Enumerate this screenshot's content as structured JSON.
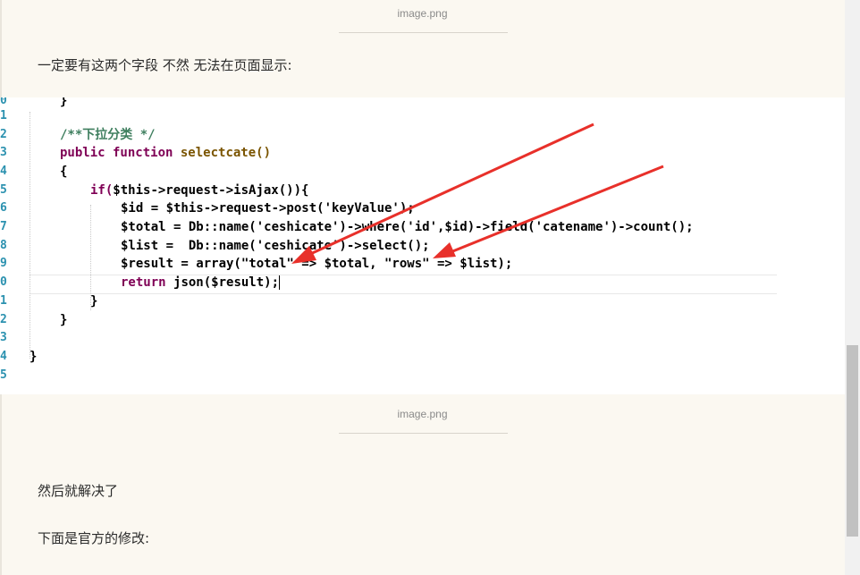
{
  "captions": {
    "top": "image.png",
    "middle": "image.png"
  },
  "paragraphs": {
    "p1": "一定要有这两个字段 不然 无法在页面显示:",
    "p2": "然后就解决了",
    "p3": "下面是官方的修改:"
  },
  "code": {
    "line_numbers": [
      "0",
      "1",
      "2",
      "3",
      "4",
      "5",
      "6",
      "7",
      "8",
      "9",
      "0",
      "1",
      "2",
      "3",
      "4",
      "5"
    ],
    "lines": {
      "l0": "}",
      "l2_comment": "/**下拉分类 */",
      "l3_kw": "public function",
      "l3_fn": "selectcate()",
      "l4": "{",
      "l5_if": "if(",
      "l5_rest": "$this->request->isAjax()){",
      "l6": "$id = $this->request->post('keyValue');",
      "l7": "$total = Db::name('ceshicate')->where('id',$id)->field('catename')->count();",
      "l8": "$list =  Db::name('ceshicate')->select();",
      "l9": "$result = array(\"total\" => $total, \"rows\" => $list);",
      "l10_kw": "return",
      "l10_rest": "json($result);",
      "l11": "}",
      "l12": "}",
      "l14": "}"
    }
  },
  "colors": {
    "arrow": "#e8302a",
    "keyword": "#7f0055",
    "string": "#2a00ff",
    "comment": "#3f7f5f",
    "line_number": "#2b91af"
  },
  "icons": {
    "annotation_arrows": "red-arrow-icon"
  }
}
